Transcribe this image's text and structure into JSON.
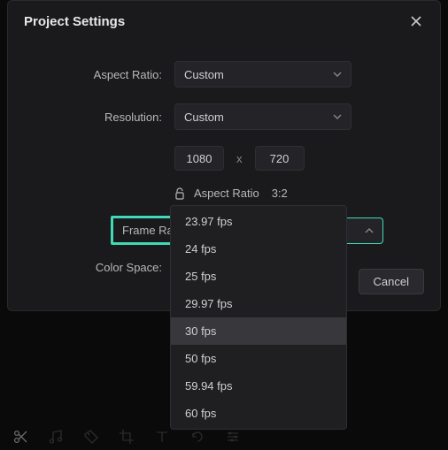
{
  "dialog": {
    "title": "Project Settings",
    "labels": {
      "aspect_ratio": "Aspect Ratio:",
      "resolution": "Resolution:",
      "frame_rate": "Frame Rate:",
      "color_space": "Color Space:"
    },
    "aspect_ratio_value": "Custom",
    "resolution_value": "Custom",
    "width": "1080",
    "height": "720",
    "lock_label": "Aspect Ratio",
    "lock_ratio": "3:2",
    "frame_rate_value": "30 fps",
    "frame_rate_options": [
      "23.97 fps",
      "24 fps",
      "25 fps",
      "29.97 fps",
      "30 fps",
      "50 fps",
      "59.94 fps",
      "60 fps"
    ],
    "frame_rate_selected_index": 4,
    "cancel": "Cancel",
    "x_sep": "x"
  }
}
